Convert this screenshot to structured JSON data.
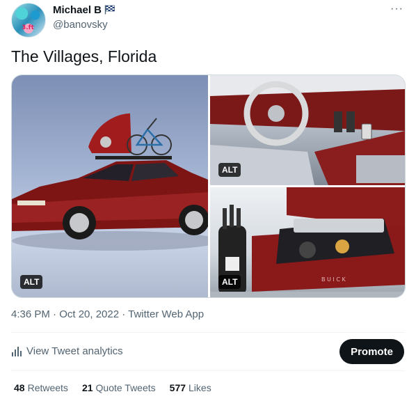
{
  "author": {
    "name": "Michael B",
    "handle": "@banovsky",
    "avatar_text": "3.ft"
  },
  "tweet": {
    "text": "The Villages, Florida"
  },
  "media": {
    "alt_labels": [
      "ALT",
      "ALT",
      "ALT"
    ],
    "images": [
      "red-buick-sedan-with-bike-rack",
      "buick-interior-dashboard",
      "buick-trunk-with-golf-bag"
    ],
    "trunk_lettering": "B U I C K"
  },
  "meta": {
    "timestamp": "4:36 PM · Oct 20, 2022 · Twitter Web App"
  },
  "actions": {
    "analytics_label": "View Tweet analytics",
    "promote_label": "Promote",
    "more_icon": "···"
  },
  "stats": {
    "retweets_count": "48",
    "retweets_label": "Retweets",
    "quotes_count": "21",
    "quotes_label": "Quote Tweets",
    "likes_count": "577",
    "likes_label": "Likes"
  },
  "colors": {
    "text_primary": "#0f1419",
    "text_secondary": "#536471",
    "promote_bg": "#0f1419",
    "car_red": "#8e1c1c"
  }
}
